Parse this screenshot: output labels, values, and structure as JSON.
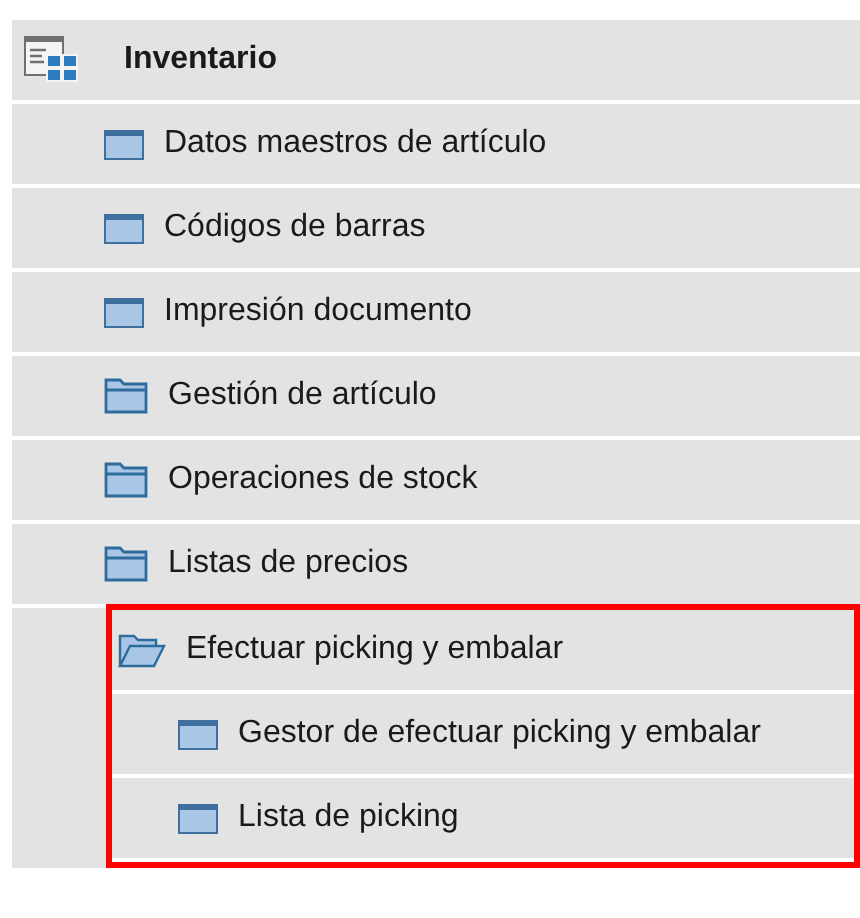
{
  "tree": {
    "label": "Inventario",
    "children": [
      {
        "label": "Datos maestros de artículo",
        "kind": "form"
      },
      {
        "label": "Códigos de barras",
        "kind": "form"
      },
      {
        "label": "Impresión documento",
        "kind": "form"
      },
      {
        "label": "Gestión de artículo",
        "kind": "folder",
        "expanded": false,
        "highlighted": false
      },
      {
        "label": "Operaciones de stock",
        "kind": "folder",
        "expanded": false,
        "highlighted": false
      },
      {
        "label": "Listas de precios",
        "kind": "folder",
        "expanded": false,
        "highlighted": false
      },
      {
        "label": "Efectuar picking y embalar",
        "kind": "folder",
        "expanded": true,
        "highlighted": true,
        "children": [
          {
            "label": "Gestor de efectuar picking y embalar",
            "kind": "form"
          },
          {
            "label": "Lista de picking",
            "kind": "form"
          }
        ]
      }
    ]
  }
}
